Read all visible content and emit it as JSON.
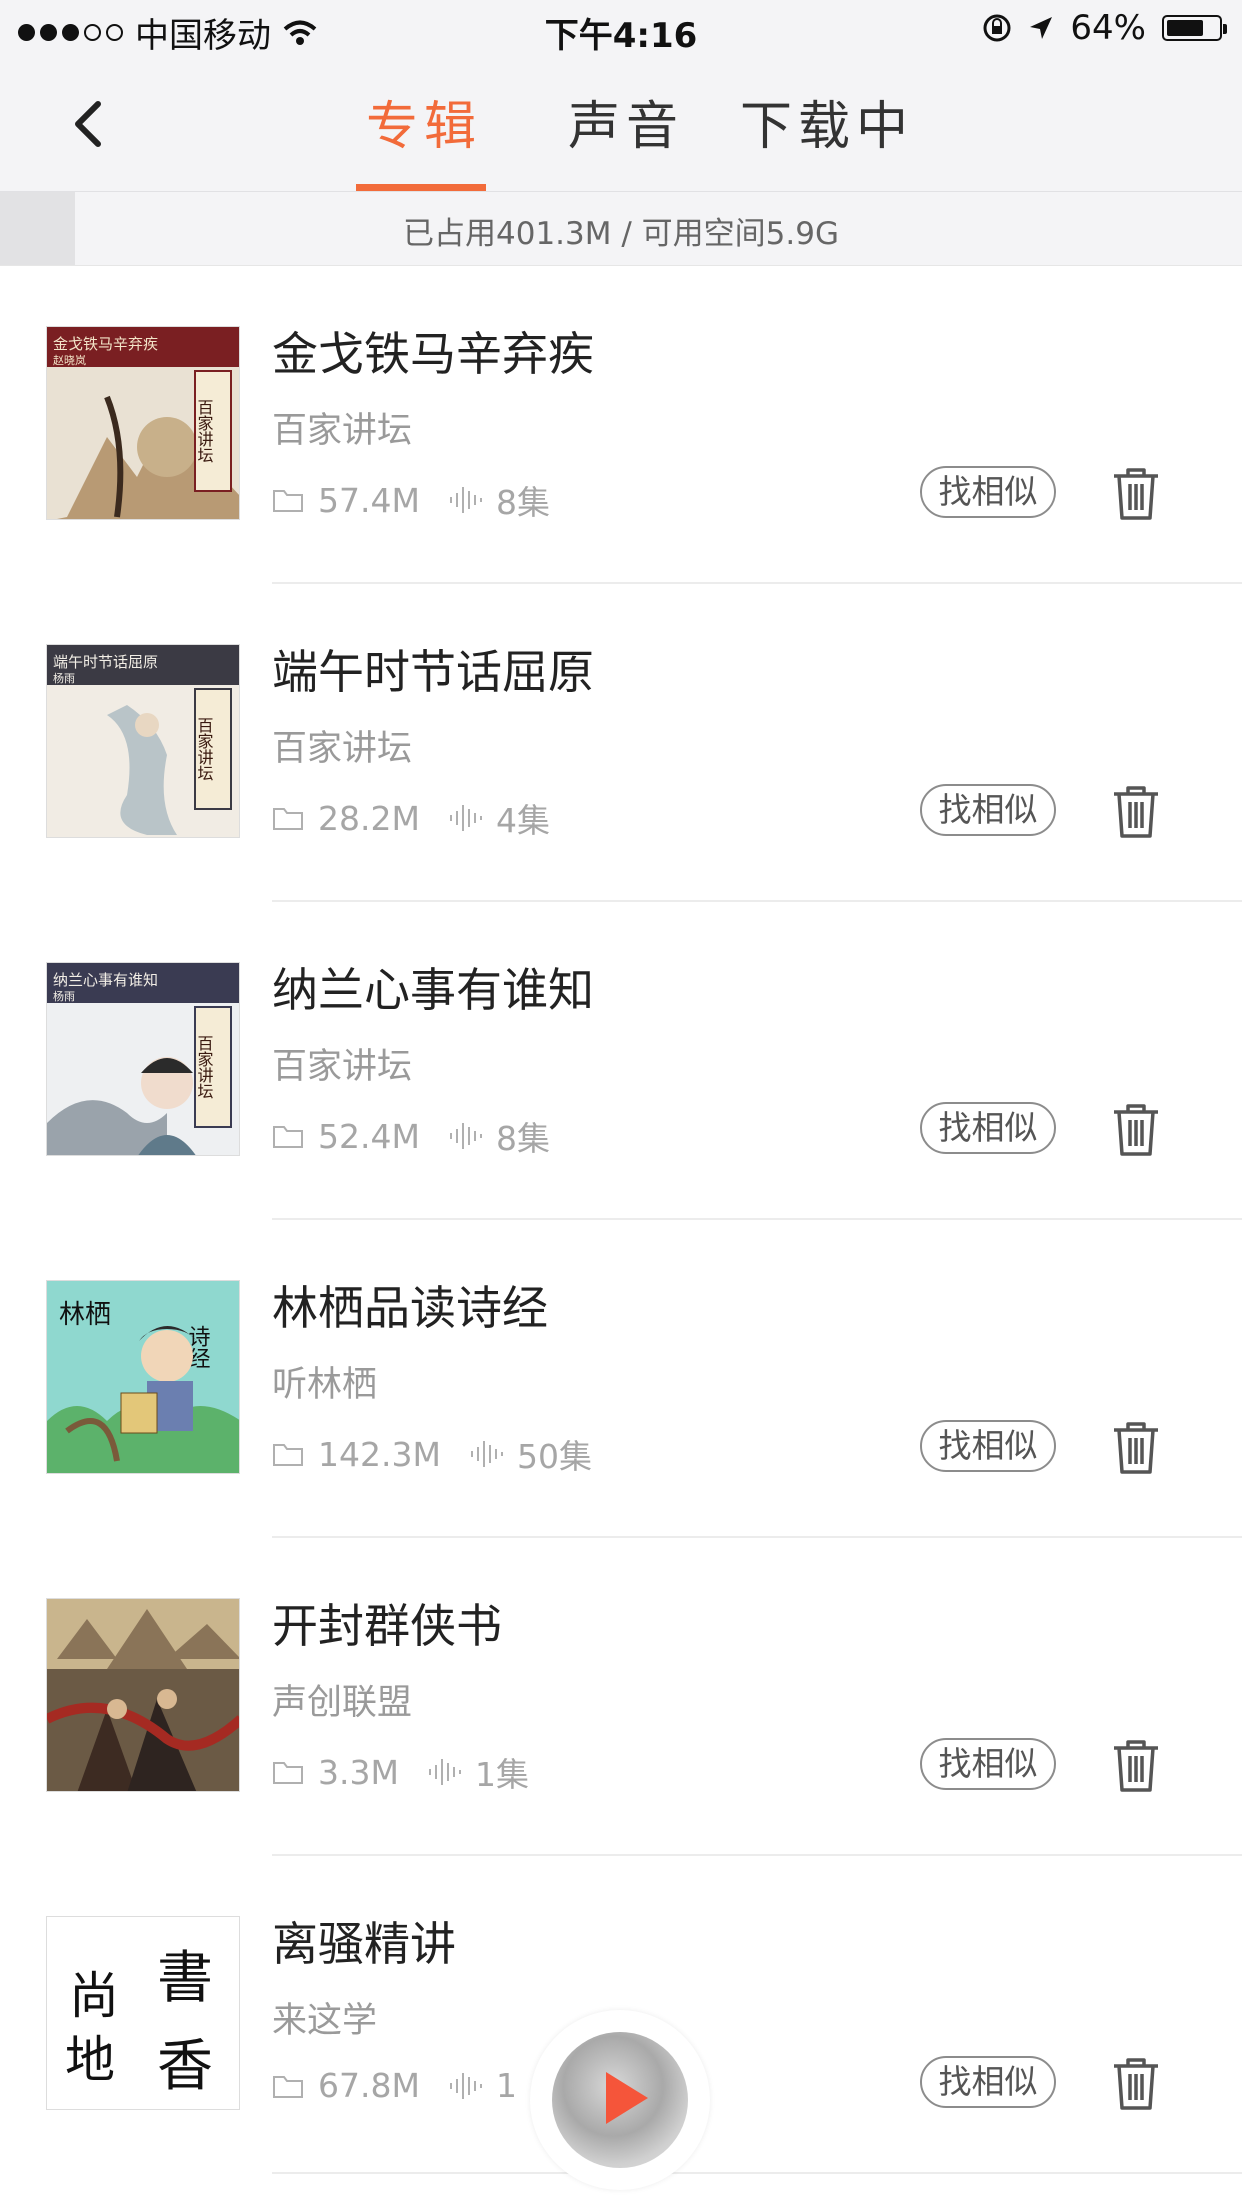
{
  "status_bar": {
    "carrier": "中国移动",
    "time": "下午4:16",
    "battery": "64%"
  },
  "nav": {
    "tabs": [
      {
        "label": "专辑",
        "active": true
      },
      {
        "label": "声音",
        "active": false
      },
      {
        "label": "下载中",
        "active": false
      }
    ],
    "accent_color": "#f26b3a"
  },
  "storage": {
    "text": "已占用401.3M / 可用空间5.9G"
  },
  "similar_label": "找相似",
  "albums": [
    {
      "title": "金戈铁马辛弃疾",
      "source": "百家讲坛",
      "size": "57.4M",
      "episodes": "8集",
      "cover_banner": "金戈铁马辛弃疾",
      "cover_author": "赵晓岚",
      "cover_tag": "百家讲坛"
    },
    {
      "title": "端午时节话屈原",
      "source": "百家讲坛",
      "size": "28.2M",
      "episodes": "4集",
      "cover_banner": "端午时节话屈原",
      "cover_author": "杨雨",
      "cover_tag": "百家讲坛"
    },
    {
      "title": "纳兰心事有谁知",
      "source": "百家讲坛",
      "size": "52.4M",
      "episodes": "8集",
      "cover_banner": "纳兰心事有谁知",
      "cover_author": "杨雨",
      "cover_tag": "百家讲坛"
    },
    {
      "title": "林栖品读诗经",
      "source": "听林栖",
      "size": "142.3M",
      "episodes": "50集",
      "cover_text_left": "林栖",
      "cover_text_right": "诗经"
    },
    {
      "title": "开封群侠书",
      "source": "声创联盟",
      "size": "3.3M",
      "episodes": "1集"
    },
    {
      "title": "离骚精讲",
      "source": "来这学",
      "size": "67.8M",
      "episodes": "1",
      "cover_chars": [
        "書",
        "尚",
        "香",
        "地"
      ]
    }
  ]
}
